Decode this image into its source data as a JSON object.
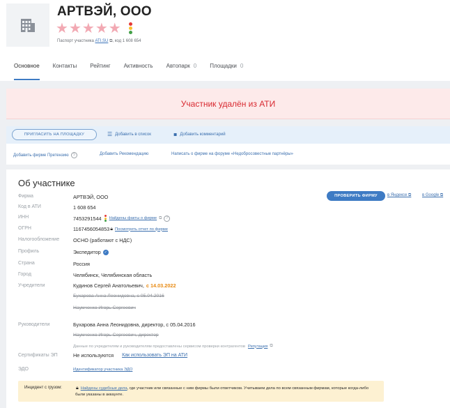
{
  "company": {
    "name": "АРТВЭЙ, ООО",
    "passport_prefix": "Паспорт участника",
    "passport_link": "ATI.SU",
    "passport_suffix": ", код 1 608 654",
    "rating_stars": 5,
    "logo_icon": "building-icon"
  },
  "tabs": [
    {
      "label": "Основное",
      "active": true
    },
    {
      "label": "Контакты"
    },
    {
      "label": "Рейтинг"
    },
    {
      "label": "Активность"
    },
    {
      "label": "Автопарк",
      "count": "0"
    },
    {
      "label": "Площадки",
      "count": "0"
    }
  ],
  "banner": {
    "text": "Участник удалён из АТИ"
  },
  "actions": {
    "invite": "ПРИГЛАСИТЬ НА ПЛОЩАДКУ",
    "add_list": "Добавить в список",
    "add_comment": "Добавить комментарий",
    "claim": "Добавить фирме Претензию",
    "recommend": "Добавить Рекомендацию",
    "forum": "Написать о фирме на форуме «Недобросовестные партнёры»"
  },
  "about": {
    "title": "Об участнике",
    "check_button": "ПРОВЕРИТЬ ФИРМУ",
    "yandex": "в Яндексе",
    "google": "в Google",
    "rows": {
      "firm": {
        "label": "Фирма",
        "value": "АРТВЭЙ, ООО"
      },
      "code": {
        "label": "Код в АТИ",
        "value": "1 608 654"
      },
      "inn": {
        "label": "ИНН",
        "value": "7453291544",
        "link": "Найдены факты о фирме"
      },
      "ogrn": {
        "label": "ОГРН",
        "value": "1167456054853",
        "link": "Посмотреть отчет по фирме"
      },
      "tax": {
        "label": "Налогообложение",
        "value": "ОСНО (работают с НДС)"
      },
      "profile": {
        "label": "Профиль",
        "value": "Экспедитор"
      },
      "country": {
        "label": "Страна",
        "value": "Россия"
      },
      "city": {
        "label": "Город",
        "value": "Челябинск, Челябинская область"
      },
      "founders": {
        "label": "Учредители",
        "current": "Кудинов Сергей Анатольевич,",
        "current_date": "с 14.03.2022",
        "former1": "Бухарова Анна Леонидовна, с 05.04.2016",
        "former2": "Наумченко Игорь Сергеевич"
      },
      "heads": {
        "label": "Руководители",
        "current": "Бухарова Анна Леонидовна, директор, с 05.04.2016",
        "former": "Наумченко Игорь Сергеевич, директор",
        "note": "Данные по учредителям и руководителям предоставлены сервисом проверки контрагентов",
        "note_link": "Репутация"
      },
      "cert": {
        "label": "Сертификаты ЭП",
        "value": "Не используются",
        "link": "Как использовать ЭП на АТИ"
      },
      "edo": {
        "label": "ЭДО",
        "link": "Идентификатор участника ЭДО"
      }
    },
    "incident": {
      "label": "Инцидент с грузом:",
      "link": "Найдены судебные дела",
      "text": ", где участник или связанные с ним фирмы были ответчиком. Учитываем дела по всем связанным фирмам, которые когда-либо были указаны в аккаунте."
    }
  },
  "colors": {
    "accent": "#3e7bc4",
    "alert": "#d8282f",
    "star": "#f2a9b3",
    "highlight": "#e88a12"
  }
}
